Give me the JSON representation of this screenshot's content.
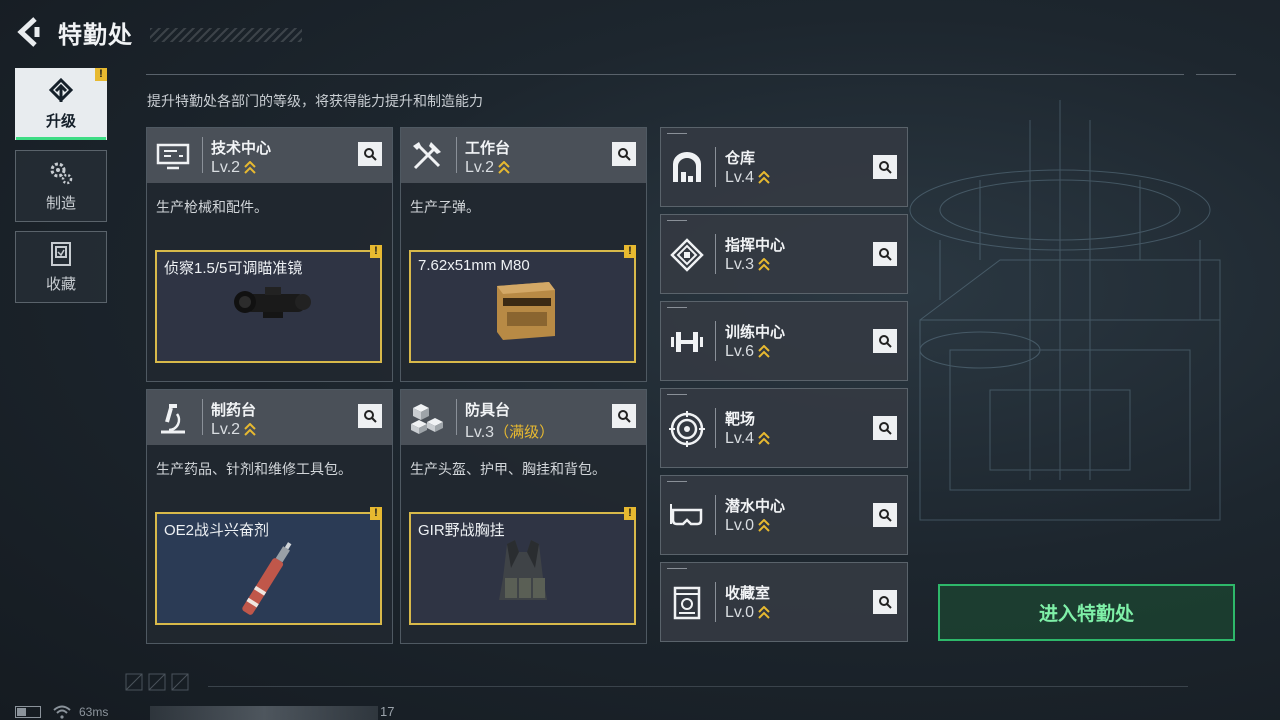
{
  "header": {
    "title": "特勤处"
  },
  "subtitle": "提升特勤处各部门的等级，将获得能力提升和制造能力",
  "sidebar": {
    "tabs": [
      {
        "label": "升级",
        "icon": "upgrade-icon",
        "active": true,
        "alert": true
      },
      {
        "label": "制造",
        "icon": "gears-icon",
        "active": false,
        "alert": false
      },
      {
        "label": "收藏",
        "icon": "collection-icon",
        "active": false,
        "alert": false
      }
    ]
  },
  "workshops": [
    {
      "name": "技术中心",
      "level": "Lv.2",
      "icon": "monitor-icon",
      "description": "生产枪械和配件。",
      "item": "侦察1.5/5可调瞄准镜",
      "item_icon": "scope-icon"
    },
    {
      "name": "工作台",
      "level": "Lv.2",
      "icon": "tools-icon",
      "description": "生产子弹。",
      "item": "7.62x51mm M80",
      "item_icon": "ammo-box-icon"
    },
    {
      "name": "制药台",
      "level": "Lv.2",
      "icon": "microscope-icon",
      "description": "生产药品、针剂和维修工具包。",
      "item": "OE2战斗兴奋剂",
      "item_icon": "injector-icon"
    },
    {
      "name": "防具台",
      "level": "Lv.3",
      "level_note": "（满级）",
      "icon": "cubes-icon",
      "description": "生产头盔、护甲、胸挂和背包。",
      "item": "GIR野战胸挂",
      "item_icon": "chest-rig-icon"
    }
  ],
  "facilities": [
    {
      "name": "仓库",
      "level": "Lv.4",
      "icon": "warehouse-icon"
    },
    {
      "name": "指挥中心",
      "level": "Lv.3",
      "icon": "chip-icon"
    },
    {
      "name": "训练中心",
      "level": "Lv.6",
      "icon": "dumbbell-icon"
    },
    {
      "name": "靶场",
      "level": "Lv.4",
      "icon": "target-icon"
    },
    {
      "name": "潜水中心",
      "level": "Lv.0",
      "icon": "diving-mask-icon"
    },
    {
      "name": "收藏室",
      "level": "Lv.0",
      "icon": "display-case-icon"
    }
  ],
  "enter_button": "进入特勤处",
  "status": {
    "ping": "63ms",
    "number": "17"
  },
  "colors": {
    "accent_green": "#2eb86a",
    "alert_yellow": "#e7b930",
    "item_border": "#d8b94a"
  }
}
